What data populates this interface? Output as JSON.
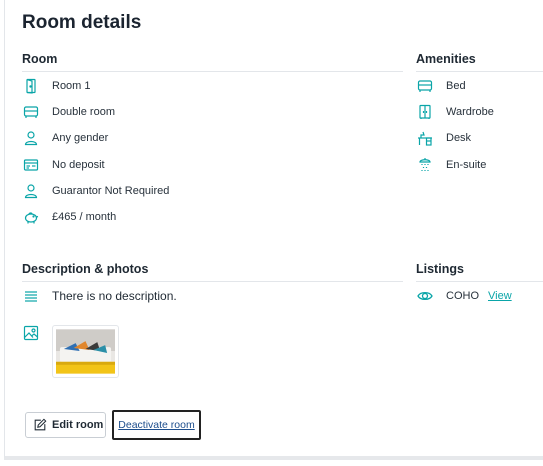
{
  "page": {
    "title": "Room details"
  },
  "room": {
    "heading": "Room",
    "items": [
      {
        "icon": "door-icon",
        "label": "Room 1"
      },
      {
        "icon": "bed-icon",
        "label": "Double room"
      },
      {
        "icon": "person-icon",
        "label": "Any gender"
      },
      {
        "icon": "deposit-card-icon",
        "label": "No deposit"
      },
      {
        "icon": "person-icon",
        "label": "Guarantor Not Required"
      },
      {
        "icon": "piggy-bank-icon",
        "label": "£465 / month"
      }
    ]
  },
  "amenities": {
    "heading": "Amenities",
    "items": [
      {
        "icon": "bed-icon",
        "label": "Bed"
      },
      {
        "icon": "wardrobe-icon",
        "label": "Wardrobe"
      },
      {
        "icon": "desk-icon",
        "label": "Desk"
      },
      {
        "icon": "shower-icon",
        "label": "En-suite"
      }
    ]
  },
  "description": {
    "heading": "Description & photos",
    "text": "There is no description."
  },
  "listings": {
    "heading": "Listings",
    "items": [
      {
        "name": "COHO",
        "link": "View"
      }
    ]
  },
  "actions": {
    "edit_label": "Edit room",
    "deactivate_label": "Deactivate room"
  },
  "colors": {
    "accent": "#0aa5a8",
    "link_dark": "#1c4d8c",
    "rule": "#e3e6ea"
  }
}
